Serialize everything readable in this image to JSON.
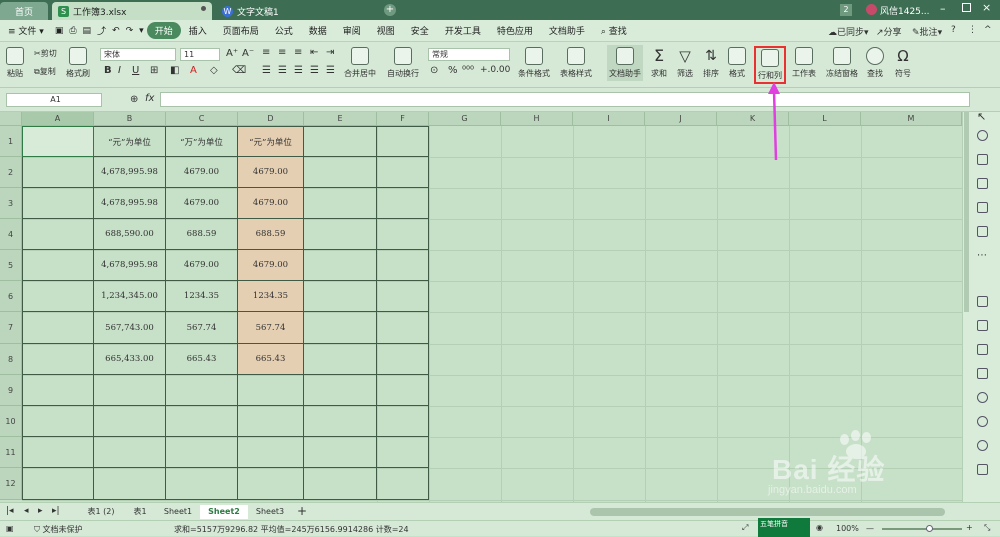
{
  "tabs": {
    "home": "首页",
    "workbook": "工作簿3.xlsx",
    "doc": "文字文稿1",
    "new_tab": "+"
  },
  "user": {
    "badge": "2",
    "name": "风信1425..."
  },
  "menu": {
    "file": "文件",
    "items": [
      "开始",
      "插入",
      "页面布局",
      "公式",
      "数据",
      "审阅",
      "视图",
      "安全",
      "开发工具",
      "特色应用",
      "文档助手"
    ],
    "search": "查找",
    "sync": "已同步",
    "share": "分享",
    "comment": "批注"
  },
  "ribbon": {
    "paste": "粘贴",
    "cut": "剪切",
    "copy": "复制",
    "format_painter": "格式刷",
    "font": "宋体",
    "size": "11",
    "merge": "合并居中",
    "wrap": "自动换行",
    "numfmt": "常规",
    "cond_format": "条件格式",
    "table_style": "表格样式",
    "doc_assist": "文档助手",
    "sum": "求和",
    "filter": "筛选",
    "sort": "排序",
    "format": "格式",
    "rowcol": "行和列",
    "worksheet": "工作表",
    "freeze": "冻结窗格",
    "find": "查找",
    "symbol": "符号"
  },
  "formula_bar": {
    "name_box": "A1",
    "fx": "fx",
    "value": ""
  },
  "columns": [
    "A",
    "B",
    "C",
    "D",
    "E",
    "F",
    "G",
    "H",
    "I",
    "J",
    "K",
    "L",
    "M"
  ],
  "rows": [
    "1",
    "2",
    "3",
    "4",
    "5",
    "6",
    "7",
    "8",
    "9",
    "10",
    "11",
    "12"
  ],
  "table": {
    "header": [
      "",
      "“元”为单位",
      "“万”为单位",
      "“元”为单位"
    ],
    "data": [
      [
        "",
        "4,678,995.98",
        "4679.00",
        "4679.00"
      ],
      [
        "",
        "4,678,995.98",
        "4679.00",
        "4679.00"
      ],
      [
        "",
        "688,590.00",
        "688.59",
        "688.59"
      ],
      [
        "",
        "4,678,995.98",
        "4679.00",
        "4679.00"
      ],
      [
        "",
        "1,234,345.00",
        "1234.35",
        "1234.35"
      ],
      [
        "",
        "567,743.00",
        "567.74",
        "567.74"
      ],
      [
        "",
        "665,433.00",
        "665.43",
        "665.43"
      ]
    ]
  },
  "sheets": [
    "表1 (2)",
    "表1",
    "Sheet1",
    "Sheet2",
    "Sheet3"
  ],
  "active_sheet": "Sheet2",
  "status": {
    "protect": "文档未保护",
    "stats": "求和=5157万9296.82  平均值=245万6156.9914286  计数=24",
    "zoom": "100%",
    "ime": "五笔拼音"
  },
  "watermark": {
    "brand": "Bai 经验",
    "url": "jingyan.baidu.com"
  },
  "colors": {
    "accent": "#4a8a5e",
    "highlight": "#e83232",
    "arrow": "#e040e0",
    "peach": "#e5cfb3"
  }
}
